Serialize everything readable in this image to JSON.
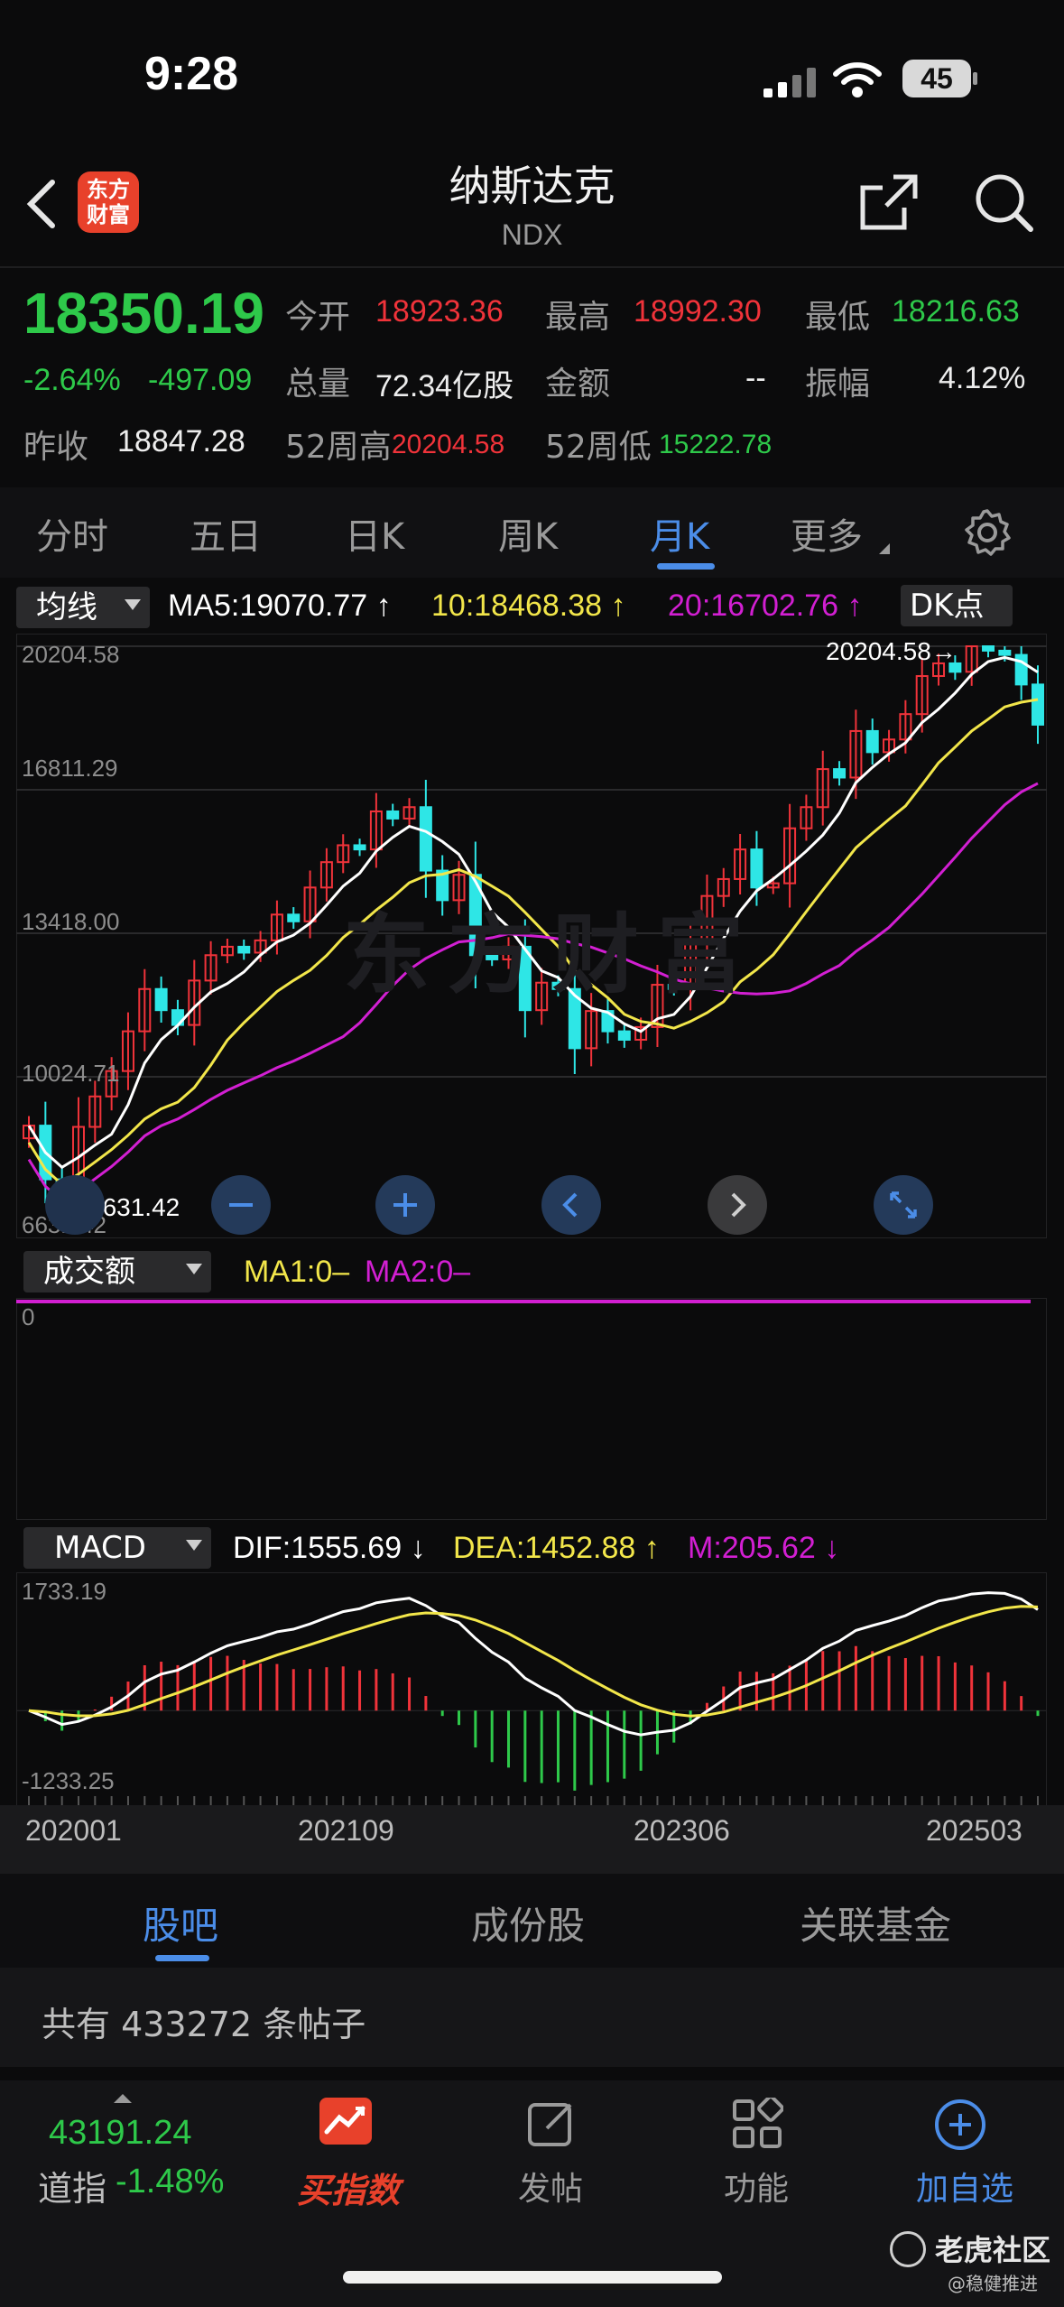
{
  "status": {
    "time": "9:28",
    "battery": "45"
  },
  "header": {
    "title": "纳斯达克",
    "code": "NDX",
    "logo_line1": "东方",
    "logo_line2": "财富"
  },
  "quote": {
    "price": "18350.19",
    "change_pct": "-2.64%",
    "change": "-497.09",
    "open_label": "今开",
    "open": "18923.36",
    "high_label": "最高",
    "high": "18992.30",
    "low_label": "最低",
    "low": "18216.63",
    "volume_label": "总量",
    "volume": "72.34亿股",
    "amount_label": "金额",
    "amount": "--",
    "amplitude_label": "振幅",
    "amplitude": "4.12%",
    "prev_close_label": "昨收",
    "prev_close": "18847.28",
    "w52_high_label": "52周高",
    "w52_high": "20204.58",
    "w52_low_label": "52周低",
    "w52_low": "15222.78"
  },
  "ktabs": [
    "分时",
    "五日",
    "日K",
    "周K",
    "月K",
    "更多"
  ],
  "ma_bar": {
    "selector": "均线",
    "ma5": "MA5:19070.77",
    "ma10": "10:18468.38",
    "ma20": "20:16702.76",
    "dk": "DK点"
  },
  "kline": {
    "y_labels": [
      "20204.58",
      "16811.29",
      "13418.00",
      "10024.71",
      "6631.42"
    ],
    "max_marker": "20204.58→",
    "min_marker": "←6631.42",
    "watermark": "东方财富"
  },
  "volume_bar": {
    "selector": "成交额",
    "ma1": "MA1:0–",
    "ma2": "MA2:0–",
    "zero": "0"
  },
  "macd_bar": {
    "selector": "MACD",
    "dif": "DIF:1555.69",
    "dea": "DEA:1452.88",
    "m": "M:205.62",
    "top": "1733.19",
    "bottom": "-1233.25"
  },
  "x_labels": [
    "202001",
    "202109",
    "202306",
    "202503"
  ],
  "bottom_tabs": [
    "股吧",
    "成份股",
    "关联基金"
  ],
  "posts": "共有 433272 条帖子",
  "nav": {
    "index_value": "43191.24",
    "index_name": "道指",
    "index_change": "-1.48%",
    "items": [
      "买指数",
      "发帖",
      "功能",
      "加自选"
    ]
  },
  "watermark_corner": {
    "line1": "老虎社区",
    "line2": "@稳健推进"
  },
  "colors": {
    "up": "#f0333a",
    "down": "#2ec94a",
    "accent": "#4b8de8",
    "ma5": "#ffffff",
    "ma10": "#f2e64a",
    "ma20": "#d21fd2"
  },
  "chart_data": {
    "type": "candlestick",
    "title": "",
    "xlabel": "",
    "ylabel": "",
    "ylim": [
      6631.42,
      20204.58
    ],
    "x_ticks": [
      "202001",
      "202109",
      "202306",
      "202503"
    ],
    "close": [
      8870,
      7600,
      7180,
      8840,
      9560,
      10160,
      11100,
      12100,
      11600,
      11250,
      12300,
      12900,
      13100,
      12960,
      13250,
      13860,
      13700,
      14500,
      15100,
      15500,
      15400,
      16300,
      16130,
      16400,
      14900,
      14200,
      14800,
      12900,
      12800,
      13100,
      11600,
      12250,
      12100,
      10700,
      11580,
      11100,
      10900,
      11200,
      12200,
      12100,
      13200,
      14300,
      14700,
      15400,
      14500,
      14600,
      15900,
      16400,
      17300,
      17100,
      18200,
      17700,
      18000,
      18600,
      19500,
      19800,
      19600,
      20204,
      20100,
      20000,
      19300,
      18350
    ],
    "ma5_last": 19070.77,
    "ma10_last": 18468.38,
    "ma20_last": 16702.76,
    "macd": {
      "dif_last": 1555.69,
      "dea_last": 1452.88,
      "m_last": 205.62,
      "ylim": [
        -1233.25,
        1733.19
      ]
    }
  }
}
